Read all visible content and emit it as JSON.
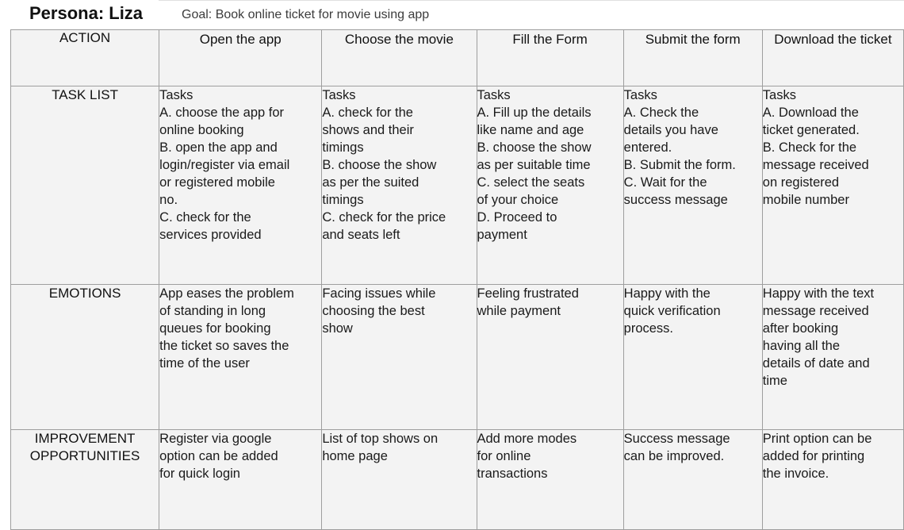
{
  "persona": "Persona: Liza",
  "goal": "Goal: Book online ticket for movie using app",
  "action_label": "ACTION",
  "stages": [
    {
      "title": "Open the app"
    },
    {
      "title": "Choose the movie"
    },
    {
      "title": "Fill the Form"
    },
    {
      "title": "Submit the form"
    },
    {
      "title": "Download the ticket"
    }
  ],
  "rows": {
    "tasks": {
      "label": "TASK LIST",
      "cells": [
        [
          "Tasks",
          "A. choose the app for",
          "online booking",
          "B. open the app and",
          "login/register via email",
          "or registered mobile",
          "no.",
          "C. check for the",
          "services provided"
        ],
        [
          "Tasks",
          "A. check for the",
          "shows and their",
          "timings",
          "B. choose the show",
          "as per the suited",
          "timings",
          "C. check for the price",
          "and seats left"
        ],
        [
          "Tasks",
          "A. Fill up the details",
          "like name and age",
          "B. choose the show",
          "as per suitable time",
          "C. select the seats",
          "of your choice",
          "D. Proceed to",
          "payment"
        ],
        [
          "Tasks",
          "A. Check the",
          "details you have",
          "entered.",
          "B. Submit the form.",
          "C. Wait for the",
          "success message"
        ],
        [
          "Tasks",
          "A. Download the",
          "ticket generated.",
          "B. Check for the",
          "message received",
          "on registered",
          "mobile number"
        ]
      ]
    },
    "emotions": {
      "label": "EMOTIONS",
      "cells": [
        [
          "App eases the problem",
          "of standing in long",
          "queues for booking",
          "the ticket so saves the",
          "time of the user"
        ],
        [
          "Facing issues while",
          "choosing the best",
          "show"
        ],
        [
          "Feeling frustrated",
          "while payment"
        ],
        [
          "Happy with the",
          "quick verification",
          "process."
        ],
        [
          "Happy with the text",
          "message received",
          "after booking",
          "having all the",
          "details of  date and",
          "time"
        ]
      ]
    },
    "improvements": {
      "label_line1": "IMPROVEMENT",
      "label_line2": "OPPORTUNITIES",
      "cells": [
        [
          "Register via google",
          "option can be added",
          "for quick login"
        ],
        [
          "List of top shows on",
          "home page"
        ],
        [
          "Add more modes",
          "for online",
          "transactions"
        ],
        [
          "Success message",
          "can be improved."
        ],
        [
          "Print option can be",
          "added for printing",
          "the invoice."
        ]
      ]
    }
  }
}
